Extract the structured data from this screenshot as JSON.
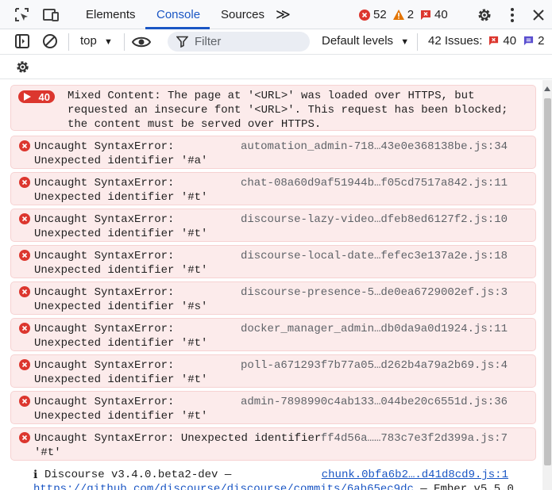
{
  "tabs": [
    {
      "label": "Elements",
      "active": false
    },
    {
      "label": "Console",
      "active": true
    },
    {
      "label": "Sources",
      "active": false
    }
  ],
  "counts": {
    "errors": "52",
    "warnings": "2",
    "issues": "40"
  },
  "toolbar": {
    "context": "top",
    "filter_placeholder": "Filter",
    "levels": "Default levels",
    "issues_label": "42 Issues:",
    "issues_errors": "40",
    "issues_info": "2"
  },
  "console": {
    "mixed": {
      "repeat_count": "40",
      "text": "Mixed Content: The page at '<URL>' was loaded over HTTPS, but\nrequested an insecure font '<URL>'. This request has been blocked;\nthe content must be served over HTTPS."
    },
    "errors": [
      {
        "text": "Uncaught SyntaxError:\nUnexpected identifier '#a'",
        "source": "automation_admin-718…43e0e368138be.js:34"
      },
      {
        "text": "Uncaught SyntaxError:\nUnexpected identifier '#t'",
        "source": "chat-08a60d9af51944b…f05cd7517a842.js:11"
      },
      {
        "text": "Uncaught SyntaxError:\nUnexpected identifier '#t'",
        "source": "discourse-lazy-video…dfeb8ed6127f2.js:10"
      },
      {
        "text": "Uncaught SyntaxError:\nUnexpected identifier '#t'",
        "source": "discourse-local-date…fefec3e137a2e.js:18"
      },
      {
        "text": "Uncaught SyntaxError:\nUnexpected identifier '#s'",
        "source": "discourse-presence-5…de0ea6729002ef.js:3"
      },
      {
        "text": "Uncaught SyntaxError:\nUnexpected identifier '#t'",
        "source": "docker_manager_admin…db0da9a0d1924.js:11"
      },
      {
        "text": "Uncaught SyntaxError:\nUnexpected identifier '#t'",
        "source": "poll-a671293f7b77a05…d262b4a79a2b69.js:4"
      },
      {
        "text": "Uncaught SyntaxError:\nUnexpected identifier '#t'",
        "source": "admin-7898990c4ab133…044be20c6551d.js:36"
      },
      {
        "text": "Uncaught SyntaxError: Unexpected identifier\n'#t'",
        "source": "ff4d56a……783c7e3f2d399a.js:7"
      }
    ],
    "info": {
      "text": "Discourse v3.4.0.beta2-dev —",
      "source": "chunk.0bfa6b2….d41d8cd9.js:1",
      "link": "https://github.com/discourse/discourse/commits/6ab65ec9dc",
      "suffix": " — Ember v5.5.0"
    }
  }
}
